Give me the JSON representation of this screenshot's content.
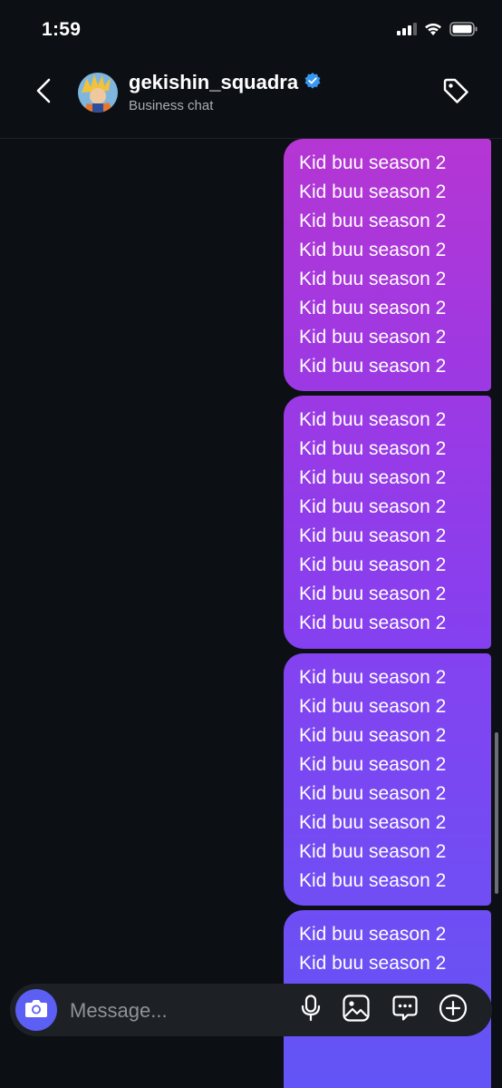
{
  "status_bar": {
    "time": "1:59"
  },
  "header": {
    "username": "gekishin_squadra",
    "subtitle": "Business chat",
    "verified": true
  },
  "messages": [
    {
      "lines": [
        "Kid buu season 2",
        "Kid buu season 2",
        "Kid buu season 2",
        "Kid buu season 2",
        "Kid buu season 2",
        "Kid buu season 2",
        "Kid buu season 2",
        "Kid buu season 2"
      ]
    },
    {
      "lines": [
        "Kid buu season 2",
        "Kid buu season 2",
        "Kid buu season 2",
        "Kid buu season 2",
        "Kid buu season 2",
        "Kid buu season 2",
        "Kid buu season 2",
        "Kid buu season 2"
      ]
    },
    {
      "lines": [
        "Kid buu season 2",
        "Kid buu season 2",
        "Kid buu season 2",
        "Kid buu season 2",
        "Kid buu season 2",
        "Kid buu season 2",
        "Kid buu season 2",
        "Kid buu season 2"
      ]
    },
    {
      "lines": [
        "Kid buu season 2",
        "Kid buu season 2"
      ]
    }
  ],
  "composer": {
    "placeholder": "Message...",
    "value": ""
  },
  "icons": {
    "status": [
      "cellular-signal-icon",
      "wifi-icon",
      "battery-icon"
    ],
    "header": [
      "back-chevron-icon",
      "verified-badge-icon",
      "tag-icon"
    ],
    "composer": [
      "camera-icon",
      "microphone-icon",
      "gallery-icon",
      "sticker-icon",
      "plus-icon"
    ]
  },
  "colors": {
    "background": "#0c1014",
    "bubble_top": "#b536d3",
    "bubble_bottom": "#5f56f6",
    "camera_button": "#5b5ff3",
    "verified_badge": "#3897f0"
  }
}
